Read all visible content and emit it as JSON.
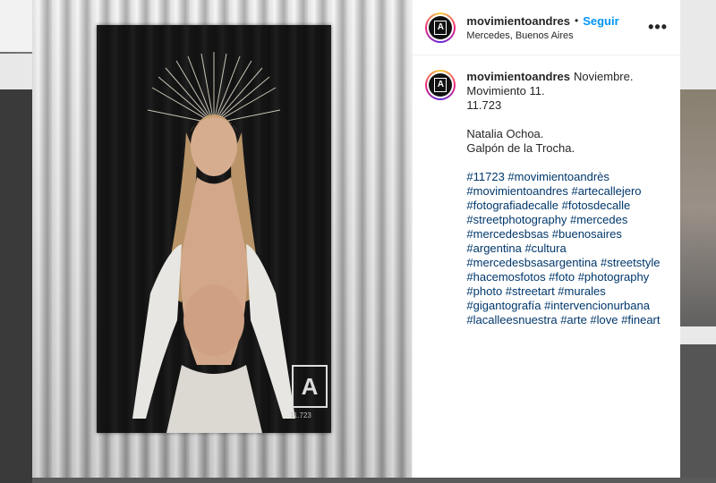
{
  "post": {
    "username": "movimientoandres",
    "follow_label": "Seguir",
    "separator": "•",
    "location": "Mercedes, Buenos Aires",
    "more_label": "•••"
  },
  "caption": {
    "username": "movimientoandres",
    "lines_first": [
      "Noviembre.",
      "Movimiento 11.",
      "11.723"
    ],
    "lines_second": [
      "Natalia Ochoa.",
      "Galpón de la Trocha."
    ],
    "hashtag_lines": [
      "#11723 #movimientoandrès",
      "#movimientoandres #artecallejero",
      "#fotografiadecalle #fotosdecalle",
      "#streetphotography #mercedes",
      "#mercedesbsas #buenosaires",
      "#argentina #cultura",
      "#mercedesbsasargentina #streetstyle",
      "#hacemosfotos #foto #photography",
      "#photo #streetart #murales",
      "#gigantografía #intervencionurbana",
      "#lacalleesnuestra #arte #love #fineart"
    ]
  },
  "photo": {
    "poster_number": "11.723",
    "logo_mark": "A"
  },
  "colors": {
    "link_blue": "#0095f6",
    "hashtag": "#00376b",
    "text": "#262626"
  }
}
